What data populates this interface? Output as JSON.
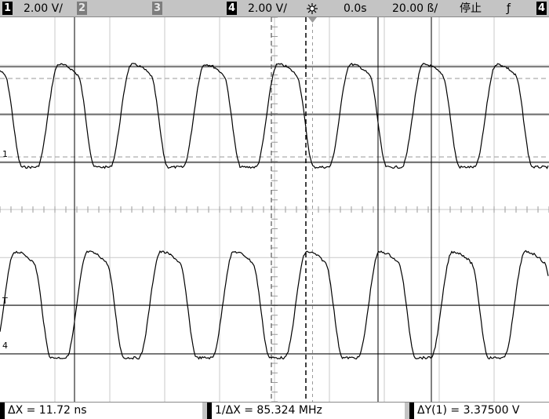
{
  "top_bar": {
    "ch1": {
      "number": "1",
      "scale": "2.00 V/"
    },
    "ch2": {
      "number": "2"
    },
    "ch3": {
      "number": "3"
    },
    "ch4": {
      "number": "4",
      "scale": "2.00 V/"
    },
    "acquire_icon": "sparkle-icon",
    "delay": "0.0s",
    "timebase": "20.00 ß/",
    "run_state": "停止",
    "trigger_slope": "ƒ",
    "trigger_source": "4"
  },
  "waveform": {
    "period_ns": 11.72,
    "ch1_amplitude_v": 3.375,
    "trace_color": "#000000",
    "grid_color": "#c8c8c8"
  },
  "markers": {
    "ch1_ground": "1",
    "trigger_level": "T",
    "ch4_ground": "4"
  },
  "bottom_bar": {
    "delta_x": "ΔX = 11.72 ns",
    "inv_delta_x": "1/ΔX = 85.324 MHz",
    "delta_y": "ΔY(1) = 3.37500 V"
  }
}
